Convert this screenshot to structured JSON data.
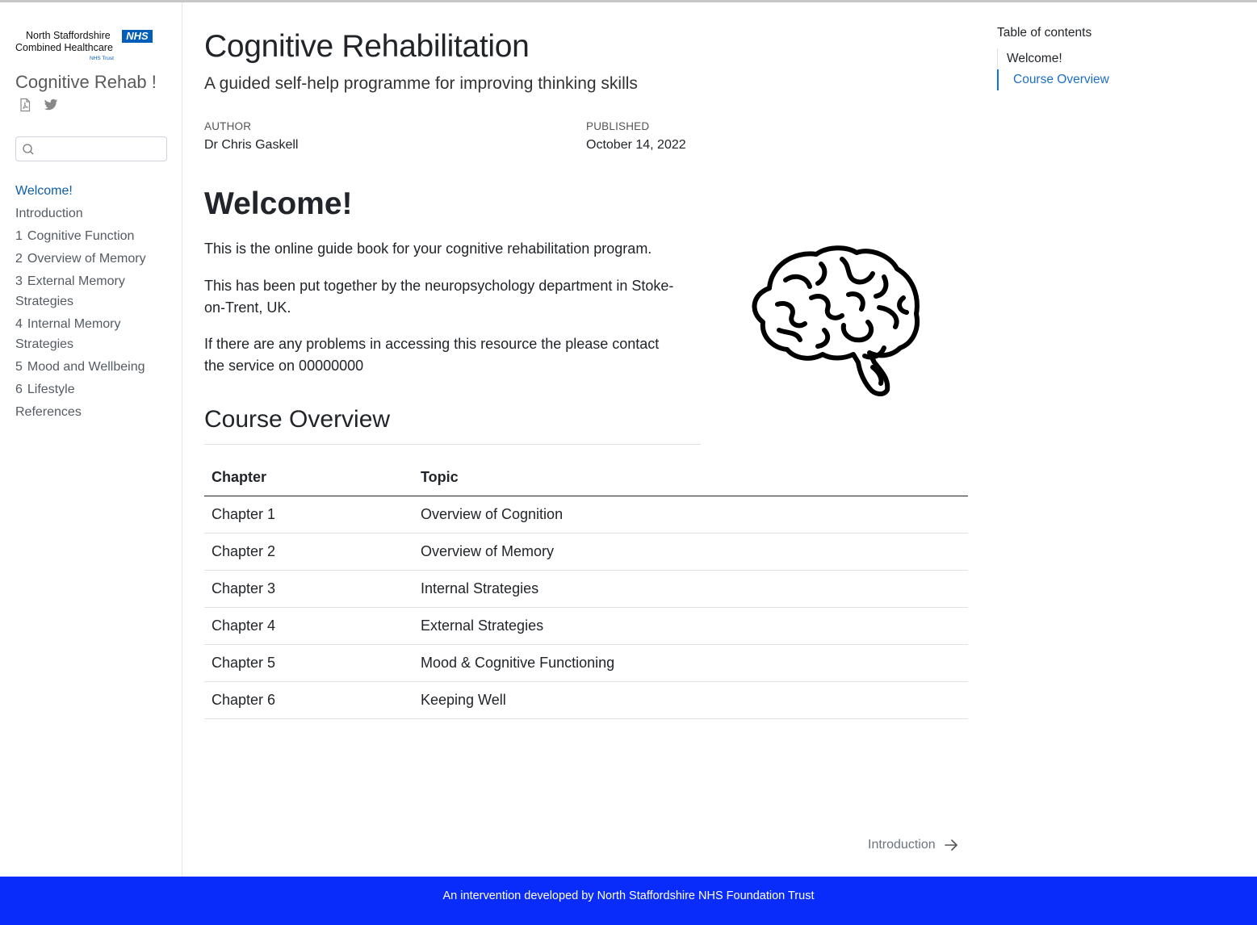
{
  "logo": {
    "line1": "North Staffordshire",
    "line2": "Combined Healthcare",
    "badge": "NHS",
    "trust": "NHS Trust"
  },
  "sidebar": {
    "site_title": "Cognitive Rehab !",
    "icons": [
      "pdf-icon",
      "twitter-icon"
    ],
    "search": {
      "placeholder": "",
      "value": ""
    },
    "items": [
      {
        "num": "",
        "label": "Welcome!",
        "active": true
      },
      {
        "num": "",
        "label": "Introduction"
      },
      {
        "num": "1",
        "label": "Cognitive Function"
      },
      {
        "num": "2",
        "label": "Overview of Memory"
      },
      {
        "num": "3",
        "label": "External Memory Strategies"
      },
      {
        "num": "4",
        "label": "Internal Memory Strategies"
      },
      {
        "num": "5",
        "label": "Mood and Wellbeing"
      },
      {
        "num": "6",
        "label": "Lifestyle"
      },
      {
        "num": "",
        "label": "References"
      }
    ]
  },
  "main": {
    "title": "Cognitive Rehabilitation",
    "subtitle": "A guided self-help programme for improving thinking skills",
    "author_label": "Author",
    "author": "Dr Chris Gaskell",
    "published_label": "Published",
    "published": "October 14, 2022",
    "welcome_heading": "Welcome!",
    "paragraphs": [
      "This is the online guide book for your cognitive rehabilitation program.",
      "This has been put together by the neuropsychology department in Stoke-on-Trent, UK.",
      "If there are any problems in accessing this resource the please contact the service on 00000000"
    ],
    "image_icon": "brain-icon",
    "course_heading": "Course Overview",
    "table": {
      "headers": [
        "Chapter",
        "Topic"
      ],
      "rows": [
        [
          "Chapter 1",
          "Overview of Cognition"
        ],
        [
          "Chapter 2",
          "Overview of Memory"
        ],
        [
          "Chapter 3",
          "Internal Strategies"
        ],
        [
          "Chapter 4",
          "External Strategies"
        ],
        [
          "Chapter 5",
          "Mood & Cognitive Functioning"
        ],
        [
          "Chapter 6",
          "Keeping Well"
        ]
      ]
    },
    "next_link": "Introduction"
  },
  "toc": {
    "title": "Table of contents",
    "items": [
      "Welcome!",
      "Course Overview"
    ]
  },
  "footer": {
    "text": "An intervention developed by North Staffordshire NHS Foundation Trust"
  },
  "colors": {
    "footer_bg": "#0a2cfa",
    "link_active": "#0d5da8",
    "nhs_blue": "#005eb8"
  }
}
